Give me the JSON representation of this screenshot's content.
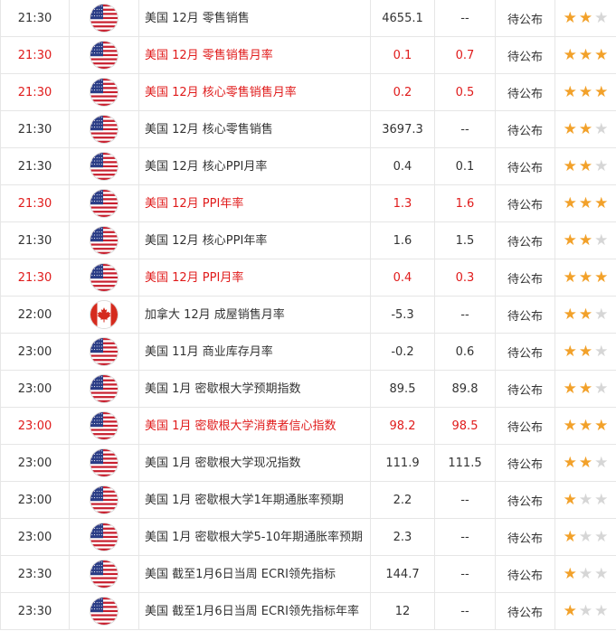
{
  "rows": [
    {
      "time": "21:30",
      "country": "us",
      "event": "美国 12月 零售销售",
      "previous": "4655.1",
      "forecast": "--",
      "actual": "待公布",
      "importance": 2,
      "highlight": false
    },
    {
      "time": "21:30",
      "country": "us",
      "event": "美国 12月 零售销售月率",
      "previous": "0.1",
      "forecast": "0.7",
      "actual": "待公布",
      "importance": 3,
      "highlight": true
    },
    {
      "time": "21:30",
      "country": "us",
      "event": "美国 12月 核心零售销售月率",
      "previous": "0.2",
      "forecast": "0.5",
      "actual": "待公布",
      "importance": 3,
      "highlight": true
    },
    {
      "time": "21:30",
      "country": "us",
      "event": "美国 12月 核心零售销售",
      "previous": "3697.3",
      "forecast": "--",
      "actual": "待公布",
      "importance": 2,
      "highlight": false
    },
    {
      "time": "21:30",
      "country": "us",
      "event": "美国 12月 核心PPI月率",
      "previous": "0.4",
      "forecast": "0.1",
      "actual": "待公布",
      "importance": 2,
      "highlight": false
    },
    {
      "time": "21:30",
      "country": "us",
      "event": "美国 12月 PPI年率",
      "previous": "1.3",
      "forecast": "1.6",
      "actual": "待公布",
      "importance": 3,
      "highlight": true
    },
    {
      "time": "21:30",
      "country": "us",
      "event": "美国 12月 核心PPI年率",
      "previous": "1.6",
      "forecast": "1.5",
      "actual": "待公布",
      "importance": 2,
      "highlight": false
    },
    {
      "time": "21:30",
      "country": "us",
      "event": "美国 12月 PPI月率",
      "previous": "0.4",
      "forecast": "0.3",
      "actual": "待公布",
      "importance": 3,
      "highlight": true
    },
    {
      "time": "22:00",
      "country": "ca",
      "event": "加拿大 12月 成屋销售月率",
      "previous": "-5.3",
      "forecast": "--",
      "actual": "待公布",
      "importance": 2,
      "highlight": false
    },
    {
      "time": "23:00",
      "country": "us",
      "event": "美国 11月 商业库存月率",
      "previous": "-0.2",
      "forecast": "0.6",
      "actual": "待公布",
      "importance": 2,
      "highlight": false
    },
    {
      "time": "23:00",
      "country": "us",
      "event": "美国 1月 密歇根大学预期指数",
      "previous": "89.5",
      "forecast": "89.8",
      "actual": "待公布",
      "importance": 2,
      "highlight": false
    },
    {
      "time": "23:00",
      "country": "us",
      "event": "美国 1月 密歇根大学消费者信心指数",
      "previous": "98.2",
      "forecast": "98.5",
      "actual": "待公布",
      "importance": 3,
      "highlight": true
    },
    {
      "time": "23:00",
      "country": "us",
      "event": "美国 1月 密歇根大学现况指数",
      "previous": "111.9",
      "forecast": "111.5",
      "actual": "待公布",
      "importance": 2,
      "highlight": false
    },
    {
      "time": "23:00",
      "country": "us",
      "event": "美国 1月 密歇根大学1年期通胀率预期",
      "previous": "2.2",
      "forecast": "--",
      "actual": "待公布",
      "importance": 1,
      "highlight": false
    },
    {
      "time": "23:00",
      "country": "us",
      "event": "美国 1月 密歇根大学5-10年期通胀率预期",
      "previous": "2.3",
      "forecast": "--",
      "actual": "待公布",
      "importance": 1,
      "highlight": false
    },
    {
      "time": "23:30",
      "country": "us",
      "event": "美国 截至1月6日当周 ECRI领先指标",
      "previous": "144.7",
      "forecast": "--",
      "actual": "待公布",
      "importance": 1,
      "highlight": false
    },
    {
      "time": "23:30",
      "country": "us",
      "event": "美国 截至1月6日当周 ECRI领先指标年率",
      "previous": "12",
      "forecast": "--",
      "actual": "待公布",
      "importance": 1,
      "highlight": false
    }
  ],
  "max_stars": 3,
  "colors": {
    "highlight": "#e01b1b",
    "text": "#333333",
    "star_on": "#f2a12a",
    "star_off": "#d6d6d6",
    "border": "#e6e6e6"
  },
  "icons": {
    "us": "us-flag-icon",
    "ca": "canada-flag-icon",
    "star": "star-icon"
  }
}
